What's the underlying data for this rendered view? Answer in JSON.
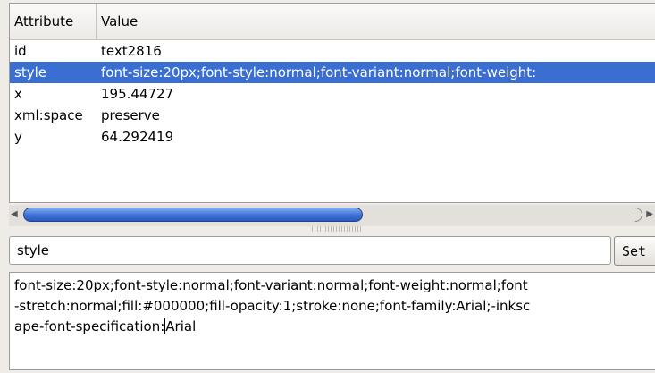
{
  "table": {
    "headers": {
      "attribute": "Attribute",
      "value": "Value"
    },
    "rows": [
      {
        "attribute": "id",
        "value": "text2816",
        "selected": false
      },
      {
        "attribute": "style",
        "value": "font-size:20px;font-style:normal;font-variant:normal;font-weight:",
        "selected": true
      },
      {
        "attribute": "x",
        "value": "195.44727",
        "selected": false
      },
      {
        "attribute": "xml:space",
        "value": "preserve",
        "selected": false
      },
      {
        "attribute": "y",
        "value": "64.292419",
        "selected": false
      }
    ]
  },
  "scrollbar": {
    "left_arrow_icon": "arrow-left-icon",
    "right_arrow_icon": "arrow-right-icon",
    "thumb_fraction": 0.55,
    "thumb_color": "#3d6fd4"
  },
  "editor": {
    "name_value": "style",
    "set_label": "Set",
    "value_lines": [
      "font-size:20px;font-style:normal;font-variant:normal;font-weight:normal;font",
      "-stretch:normal;fill:#000000;fill-opacity:1;stroke:none;font-family:Arial;-inksc",
      "ape-font-specification:",
      "Arial"
    ]
  },
  "colors": {
    "selection": "#3a6ed0",
    "background": "#efebe7"
  }
}
